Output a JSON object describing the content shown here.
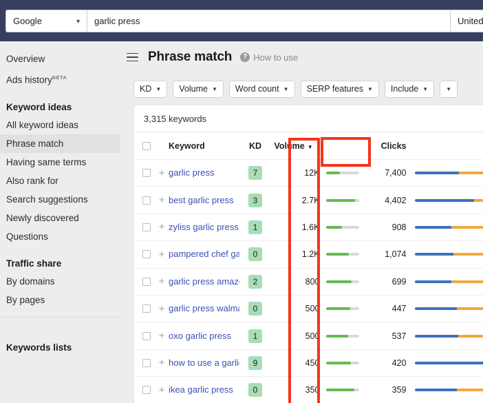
{
  "topbar": {
    "search_engine": "Google",
    "caret": "▼",
    "query": "garlic press",
    "country": "United"
  },
  "sidebar": {
    "groups": [
      {
        "heading": null,
        "items": [
          {
            "label": "Overview",
            "badge": null,
            "active": false
          },
          {
            "label": "Ads history",
            "badge": "BETA",
            "active": false
          }
        ]
      },
      {
        "heading": "Keyword ideas",
        "items": [
          {
            "label": "All keyword ideas",
            "badge": null,
            "active": false
          },
          {
            "label": "Phrase match",
            "badge": null,
            "active": true
          },
          {
            "label": "Having same terms",
            "badge": null,
            "active": false
          },
          {
            "label": "Also rank for",
            "badge": null,
            "active": false
          },
          {
            "label": "Search suggestions",
            "badge": null,
            "active": false
          },
          {
            "label": "Newly discovered",
            "badge": null,
            "active": false
          },
          {
            "label": "Questions",
            "badge": null,
            "active": false
          }
        ]
      },
      {
        "heading": "Traffic share",
        "items": [
          {
            "label": "By domains",
            "badge": null,
            "active": false
          },
          {
            "label": "By pages",
            "badge": null,
            "active": false
          }
        ]
      }
    ],
    "footer_heading": "Keywords lists"
  },
  "main": {
    "title": "Phrase match",
    "help_icon_glyph": "?",
    "help_label": "How to use",
    "menu_icon": "hamburger-icon",
    "filters": [
      {
        "label": "KD",
        "caret": "▼"
      },
      {
        "label": "Volume",
        "caret": "▼"
      },
      {
        "label": "Word count",
        "caret": "▼"
      },
      {
        "label": "SERP features",
        "caret": "▼"
      },
      {
        "label": "Include",
        "caret": "▼"
      },
      {
        "label": "",
        "caret": "▼"
      }
    ],
    "keyword_count": "3,315 keywords",
    "columns": {
      "keyword": "Keyword",
      "kd": "KD",
      "volume": "Volume",
      "volume_caret": "▼",
      "clicks": "Clicks"
    },
    "plus_glyph": "+",
    "rows": [
      {
        "keyword": "garlic press",
        "kd": "7",
        "kd_color": "#a8ddb5",
        "volume": "12K",
        "volume_pct": 42,
        "clicks": "7,400",
        "clicks_blue_pct": 63,
        "clicks_orange_pct": 37
      },
      {
        "keyword": "best garlic press",
        "kd": "3",
        "kd_color": "#a8ddb5",
        "volume": "2.7K",
        "volume_pct": 88,
        "clicks": "4,402",
        "clicks_blue_pct": 84,
        "clicks_orange_pct": 16
      },
      {
        "keyword": "zyliss garlic press",
        "kd": "1",
        "kd_color": "#a8ddb5",
        "volume": "1.6K",
        "volume_pct": 48,
        "clicks": "908",
        "clicks_blue_pct": 52,
        "clicks_orange_pct": 48
      },
      {
        "keyword": "pampered chef garlic press",
        "kd": "0",
        "kd_color": "#a8ddb5",
        "volume": "1.2K",
        "volume_pct": 70,
        "clicks": "1,074",
        "clicks_blue_pct": 55,
        "clicks_orange_pct": 45
      },
      {
        "keyword": "garlic press amazon",
        "kd": "2",
        "kd_color": "#a8ddb5",
        "volume": "800",
        "volume_pct": 78,
        "clicks": "699",
        "clicks_blue_pct": 52,
        "clicks_orange_pct": 48
      },
      {
        "keyword": "garlic press walmart",
        "kd": "0",
        "kd_color": "#a8ddb5",
        "volume": "500",
        "volume_pct": 74,
        "clicks": "447",
        "clicks_blue_pct": 60,
        "clicks_orange_pct": 40
      },
      {
        "keyword": "oxo garlic press",
        "kd": "1",
        "kd_color": "#a8ddb5",
        "volume": "500",
        "volume_pct": 68,
        "clicks": "537",
        "clicks_blue_pct": 62,
        "clicks_orange_pct": 38
      },
      {
        "keyword": "how to use a garlic press",
        "kd": "9",
        "kd_color": "#a8ddb5",
        "volume": "450",
        "volume_pct": 76,
        "clicks": "420",
        "clicks_blue_pct": 100,
        "clicks_orange_pct": 0
      },
      {
        "keyword": "ikea garlic press",
        "kd": "0",
        "kd_color": "#a8ddb5",
        "volume": "350",
        "volume_pct": 86,
        "clicks": "359",
        "clicks_blue_pct": 60,
        "clicks_orange_pct": 40
      }
    ]
  },
  "annotations": {
    "color": "#f4351a",
    "boxes": [
      {
        "name": "kd-column-highlight"
      },
      {
        "name": "volume-header-highlight"
      }
    ]
  }
}
